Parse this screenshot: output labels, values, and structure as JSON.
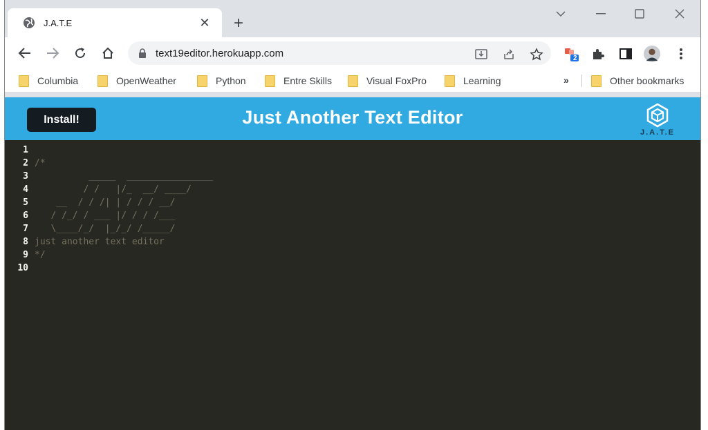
{
  "browser": {
    "tab": {
      "title": "J.A.T.E",
      "favicon": "globe-icon",
      "close_label": "✕"
    },
    "new_tab_label": "+",
    "url": "text19editor.herokuapp.com",
    "extension_badge": "2",
    "bookmarks": [
      "Columbia",
      "OpenWeather",
      "Python",
      "Entre Skills",
      "Visual FoxPro",
      "Learning"
    ],
    "bookmarks_more": "»",
    "other_bookmarks": "Other bookmarks"
  },
  "app": {
    "install_label": "Install!",
    "title": "Just Another Text Editor",
    "logo_text": "J.A.T.E",
    "header_color": "#31a9e1",
    "editor_bg": "#272822"
  },
  "editor": {
    "lines": [
      {
        "num": "1",
        "text": ""
      },
      {
        "num": "2",
        "text": "/*"
      },
      {
        "num": "3",
        "text": "          _____  ________________"
      },
      {
        "num": "4",
        "text": "         / /   |/_  __/ ____/"
      },
      {
        "num": "5",
        "text": "    __  / / /| | / / / __/"
      },
      {
        "num": "6",
        "text": "   / /_/ / ___ |/ / / /___"
      },
      {
        "num": "7",
        "text": "   \\____/_/  |_/_/ /_____/"
      },
      {
        "num": "8",
        "text": "just another text editor"
      },
      {
        "num": "9",
        "text": "*/"
      },
      {
        "num": "10",
        "text": ""
      }
    ]
  }
}
